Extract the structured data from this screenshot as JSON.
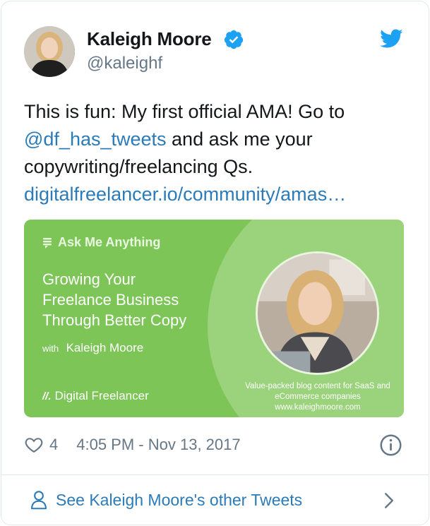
{
  "user": {
    "name": "Kaleigh Moore",
    "handle": "@kaleighf",
    "verified": true
  },
  "tweet": {
    "line1": "This is fun: My first official AMA! Go to",
    "mention": "@df_has_tweets",
    "line2_rest": " and ask me your",
    "line3": "copywriting/freelancing Qs.",
    "link": "digitalfreelancer.io/community/amas…"
  },
  "media": {
    "label": "Ask Me Anything",
    "headline": [
      "Growing Your",
      "Freelance Business",
      "Through Better Copy"
    ],
    "with_prefix": "with",
    "with_name": "Kaleigh Moore",
    "brand_mark": "//.",
    "brand": "Digital Freelancer",
    "tagline": [
      "Value-packed blog content for SaaS and",
      "eCommerce companies",
      "www.kaleighmoore.com"
    ]
  },
  "meta": {
    "likes": "4",
    "timestamp": "4:05 PM - Nov 13, 2017"
  },
  "footer": {
    "link": "See Kaleigh Moore's other Tweets"
  },
  "colors": {
    "link": "#2b7bb9",
    "muted": "#657786",
    "verified": "#1da1f2",
    "media_green": "#7cc556"
  },
  "icons": [
    "verified-badge-icon",
    "twitter-bird-icon",
    "heart-icon",
    "info-icon",
    "person-icon",
    "chevron-right-icon"
  ]
}
